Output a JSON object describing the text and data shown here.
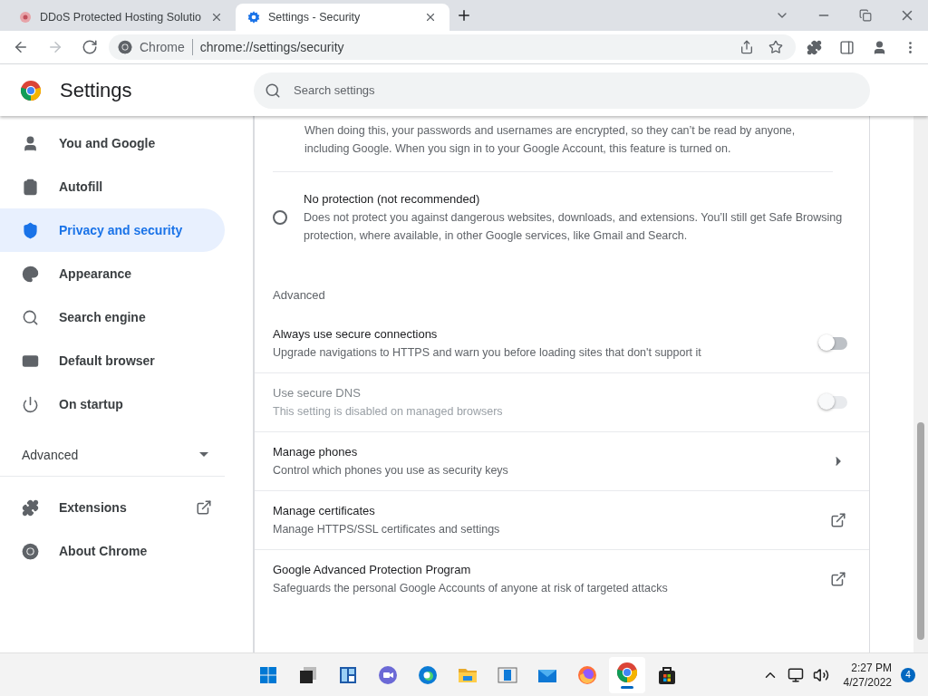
{
  "tabs": [
    {
      "title": "DDoS Protected Hosting Solutio",
      "selected": false
    },
    {
      "title": "Settings - Security",
      "selected": true
    }
  ],
  "nav_buttons": [
    {
      "kind": "back",
      "disabled": false
    },
    {
      "kind": "forward",
      "disabled": true
    },
    {
      "kind": "reload",
      "disabled": false
    }
  ],
  "address_bar": {
    "site_label": "Chrome",
    "url": "chrome://settings/security"
  },
  "header": {
    "title": "Settings",
    "search": {
      "placeholder": "Search settings"
    }
  },
  "sidebar": {
    "items": [
      {
        "label": "You and Google",
        "selected": false
      },
      {
        "label": "Autofill",
        "selected": false
      },
      {
        "label": "Privacy and security",
        "selected": true
      },
      {
        "label": "Appearance",
        "selected": false
      },
      {
        "label": "Search engine",
        "selected": false
      },
      {
        "label": "Default browser",
        "selected": false
      },
      {
        "label": "On startup",
        "selected": false
      }
    ],
    "advanced": {
      "label": "Advanced",
      "expanded": false
    },
    "bottom_items": [
      {
        "label": "Extensions",
        "external": true
      },
      {
        "label": "About Chrome",
        "external": false
      }
    ]
  },
  "safe_browsing_rows": [
    {
      "kind": "text",
      "description": "When doing this, your passwords and usernames are encrypted, so they can’t be read by anyone, including Google. When you sign in to your Google Account, this feature is turned on."
    },
    {
      "kind": "radio",
      "title": "No protection (not recommended)",
      "description": "Does not protect you against dangerous websites, downloads, and extensions. You’ll still get Safe Browsing protection, where available, in other Google services, like Gmail and Search.",
      "selected": false
    }
  ],
  "advanced_heading": "Advanced",
  "advanced_rows": [
    {
      "kind": "toggle",
      "title": "Always use secure connections",
      "description": "Upgrade navigations to HTTPS and warn you before loading sites that don't support it",
      "on": false,
      "disabled": false
    },
    {
      "kind": "toggle",
      "title": "Use secure DNS",
      "description": "This setting is disabled on managed browsers",
      "on": false,
      "disabled": true
    },
    {
      "kind": "subpage",
      "title": "Manage phones",
      "description": "Control which phones you use as security keys"
    },
    {
      "kind": "external",
      "title": "Manage certificates",
      "description": "Manage HTTPS/SSL certificates and settings"
    },
    {
      "kind": "external",
      "title": "Google Advanced Protection Program",
      "description": "Safeguards the personal Google Accounts of anyone at risk of targeted attacks"
    }
  ],
  "taskbar": {
    "apps": [
      {
        "running": false
      },
      {
        "running": false
      },
      {
        "running": false
      },
      {
        "running": false
      },
      {
        "running": false
      },
      {
        "running": false
      },
      {
        "running": false
      },
      {
        "running": false
      },
      {
        "running": false
      },
      {
        "running": true
      },
      {
        "running": false
      }
    ],
    "time": "2:27 PM",
    "date": "4/27/2022",
    "notification_count": "4"
  }
}
